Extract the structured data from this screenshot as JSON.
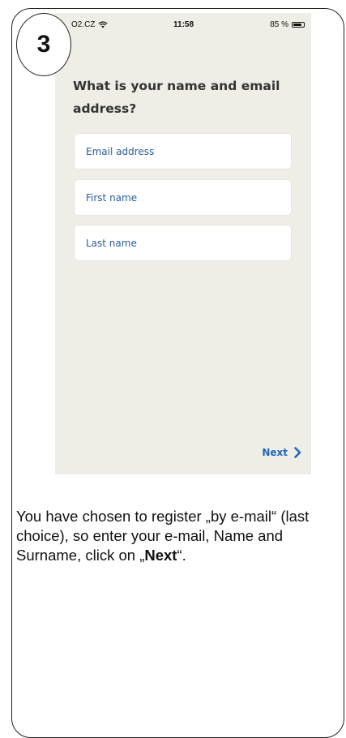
{
  "step": {
    "number": "3"
  },
  "status_bar": {
    "carrier": "O2.CZ",
    "time": "11:58",
    "battery": "85 %",
    "battery_level": 0.85
  },
  "form": {
    "question": "What is your name and email address?",
    "email_placeholder": "Email address",
    "first_name_placeholder": "First name",
    "last_name_placeholder": "Last name",
    "next_label": "Next"
  },
  "instruction": {
    "text": "You have chosen to register „by e-mail“ (last choice), so enter your e-mail, Name and Surname, click on ",
    "open_quote": "„",
    "bold": "Next",
    "close_quote": "“."
  },
  "colors": {
    "phone_background": "#eeede6",
    "field_text": "#2a5c99",
    "next_accent": "#1f67b8"
  },
  "icons": {
    "wifi": "wifi-icon",
    "battery": "battery-icon",
    "next": "chevron-right-icon"
  }
}
